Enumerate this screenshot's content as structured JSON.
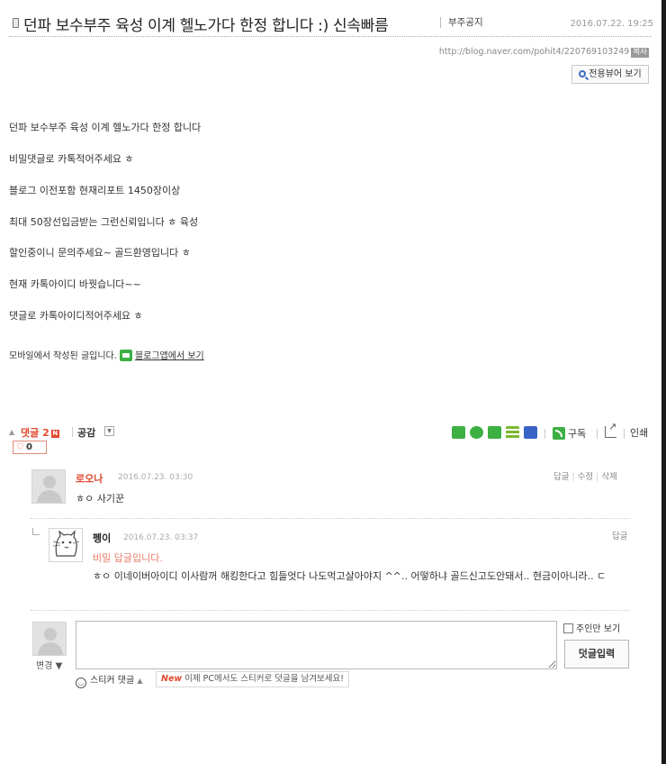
{
  "post": {
    "title": "던파 보수부주 육성 이계 헬노가다 한정 합니다 :) 신속빠름",
    "category": "부주공지",
    "date": "2016.07.22. 19:25",
    "url": "http://blog.naver.com/pohit4/220769103249",
    "copy_label": "복사",
    "viewer_button": "전용뷰어 보기",
    "body": [
      "던파 보수부주 육성 이계 헬노가다 한정 합니다",
      "비밀댓글로 카톡적어주세요 ㅎ",
      "블로그 이전포함 현재리포트 1450장이상",
      "최대 50장선입금받는 그런신뢰입니다 ㅎ 육성",
      "할인중이니 문의주세요~ 골드환영입니다 ㅎ",
      "현재 카톡아이디 바꿧습니다~~",
      "댓글로 카톡아이디적어주세요 ㅎ"
    ],
    "mobile_note": "모바일에서 작성된 글입니다.",
    "mobile_link": "블로그앱에서 보기"
  },
  "bar": {
    "comment_label": "댓글",
    "comment_count": "2",
    "reply_badge": "N",
    "like_label": "공감",
    "like_count": "0",
    "subscribe_label": "구독",
    "print_label": "인쇄",
    "share_icons": [
      "blog-share-icon",
      "cafe-share-icon",
      "bookmark-share-icon",
      "memo-share-icon",
      "calendar-share-icon"
    ]
  },
  "comments": [
    {
      "author": "로오나",
      "date": "2016.07.23. 03:30",
      "text": "ㅎㅇ 사기꾼",
      "actions": [
        "답글",
        "수정",
        "삭제"
      ]
    },
    {
      "author": "펭이",
      "date": "2016.07.23. 03:37",
      "secret": "비밀 답글입니다.",
      "text": "ㅎㅇ 이네이버아이디 이사람꺼 해킹한다고 힘들엇다 나도먹고살아야지 ^^.. 어떻하냐 골드신고도안돼서.. 현금이아니라.. ㄷ",
      "actions": [
        "답글"
      ]
    }
  ],
  "write": {
    "change_label": "변경",
    "owner_only_label": "주인만 보기",
    "submit_label": "덧글입력",
    "sticker_label": "스티커 댓글",
    "sticker_tip_new": "New",
    "sticker_tip": "이제 PC에서도 스티커로 덧글을 남겨보세요!"
  },
  "colors": {
    "accent": "#e0492e",
    "secret_text": "#e77b6a",
    "green": "#3cb043"
  }
}
